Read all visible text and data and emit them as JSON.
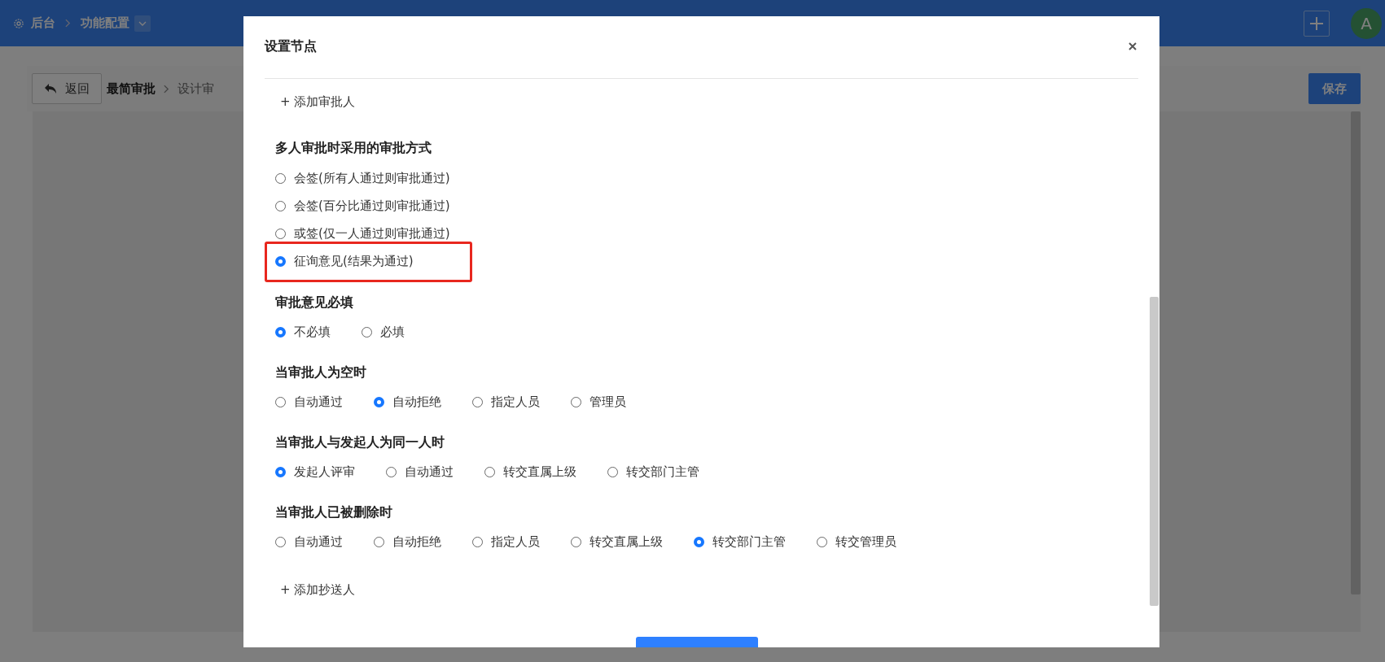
{
  "topbar": {
    "breadcrumb": [
      "后台",
      "功能配置"
    ],
    "avatar": "A"
  },
  "toolbar": {
    "back": "返回",
    "crumbs": [
      "最简审批",
      "设计审"
    ],
    "save": "保存"
  },
  "dialog": {
    "title": "设置节点",
    "add_approver": "+ 添加审批人",
    "sections": [
      {
        "title": "多人审批时采用的审批方式",
        "kind": "column",
        "options": [
          {
            "label": "会签(所有人通过则审批通过)",
            "selected": false,
            "highlighted": false
          },
          {
            "label": "会签(百分比通过则审批通过)",
            "selected": false,
            "highlighted": false
          },
          {
            "label": "或签(仅一人通过则审批通过)",
            "selected": false,
            "highlighted": false
          },
          {
            "label": "征询意见(结果为通过)",
            "selected": true,
            "highlighted": true
          }
        ]
      },
      {
        "title": "审批意见必填",
        "kind": "row",
        "options": [
          {
            "label": "不必填",
            "selected": true
          },
          {
            "label": "必填",
            "selected": false
          }
        ]
      },
      {
        "title": "当审批人为空时",
        "kind": "row",
        "options": [
          {
            "label": "自动通过",
            "selected": false
          },
          {
            "label": "自动拒绝",
            "selected": true
          },
          {
            "label": "指定人员",
            "selected": false
          },
          {
            "label": "管理员",
            "selected": false
          }
        ]
      },
      {
        "title": "当审批人与发起人为同一人时",
        "kind": "row",
        "options": [
          {
            "label": "发起人评审",
            "selected": true
          },
          {
            "label": "自动通过",
            "selected": false
          },
          {
            "label": "转交直属上级",
            "selected": false
          },
          {
            "label": "转交部门主管",
            "selected": false
          }
        ]
      },
      {
        "title": "当审批人已被删除时",
        "kind": "row",
        "options": [
          {
            "label": "自动通过",
            "selected": false
          },
          {
            "label": "自动拒绝",
            "selected": false
          },
          {
            "label": "指定人员",
            "selected": false
          },
          {
            "label": "转交直属上级",
            "selected": false
          },
          {
            "label": "转交部门主管",
            "selected": true
          },
          {
            "label": "转交管理员",
            "selected": false
          }
        ]
      }
    ],
    "add_cc": "+ 添加抄送人"
  }
}
